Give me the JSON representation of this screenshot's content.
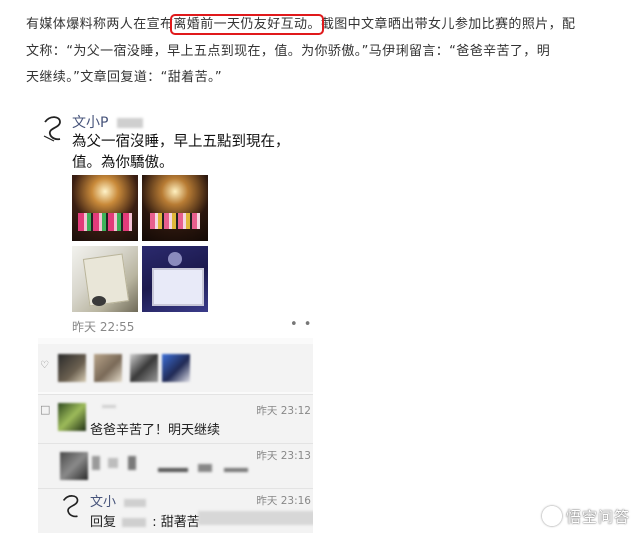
{
  "article": {
    "line1_before": "有媒体爆料称两人在宣布",
    "line1_highlight": "离婚前一天仍友好互动。",
    "line1_after": "截图中文章晒出带女儿参加比赛的照片，配",
    "line2": "文称：“为父一宿没睡，早上五点到现在，值。为你骄傲。”马伊琍留言：“爸爸辛苦了，明",
    "line3": "天继续。”文章回复道：“甜着苦。”"
  },
  "post": {
    "author": "文小P",
    "text": "為父一宿沒睡，早上五點到現在，值。為你驕傲。",
    "time": "昨天 22:55",
    "more": "• •"
  },
  "comments": [
    {
      "text": "爸爸辛苦了！明天继续",
      "time": "昨天 23:12"
    },
    {
      "text": "",
      "time": "昨天 23:13"
    },
    {
      "author": "文小",
      "text_prefix": "回复",
      "text": ": 甜著苦",
      "time": "昨天 23:16"
    }
  ],
  "watermark": "悟空问答",
  "colors": {
    "highlight_box": "#e0191b",
    "author_link": "#46537a"
  }
}
